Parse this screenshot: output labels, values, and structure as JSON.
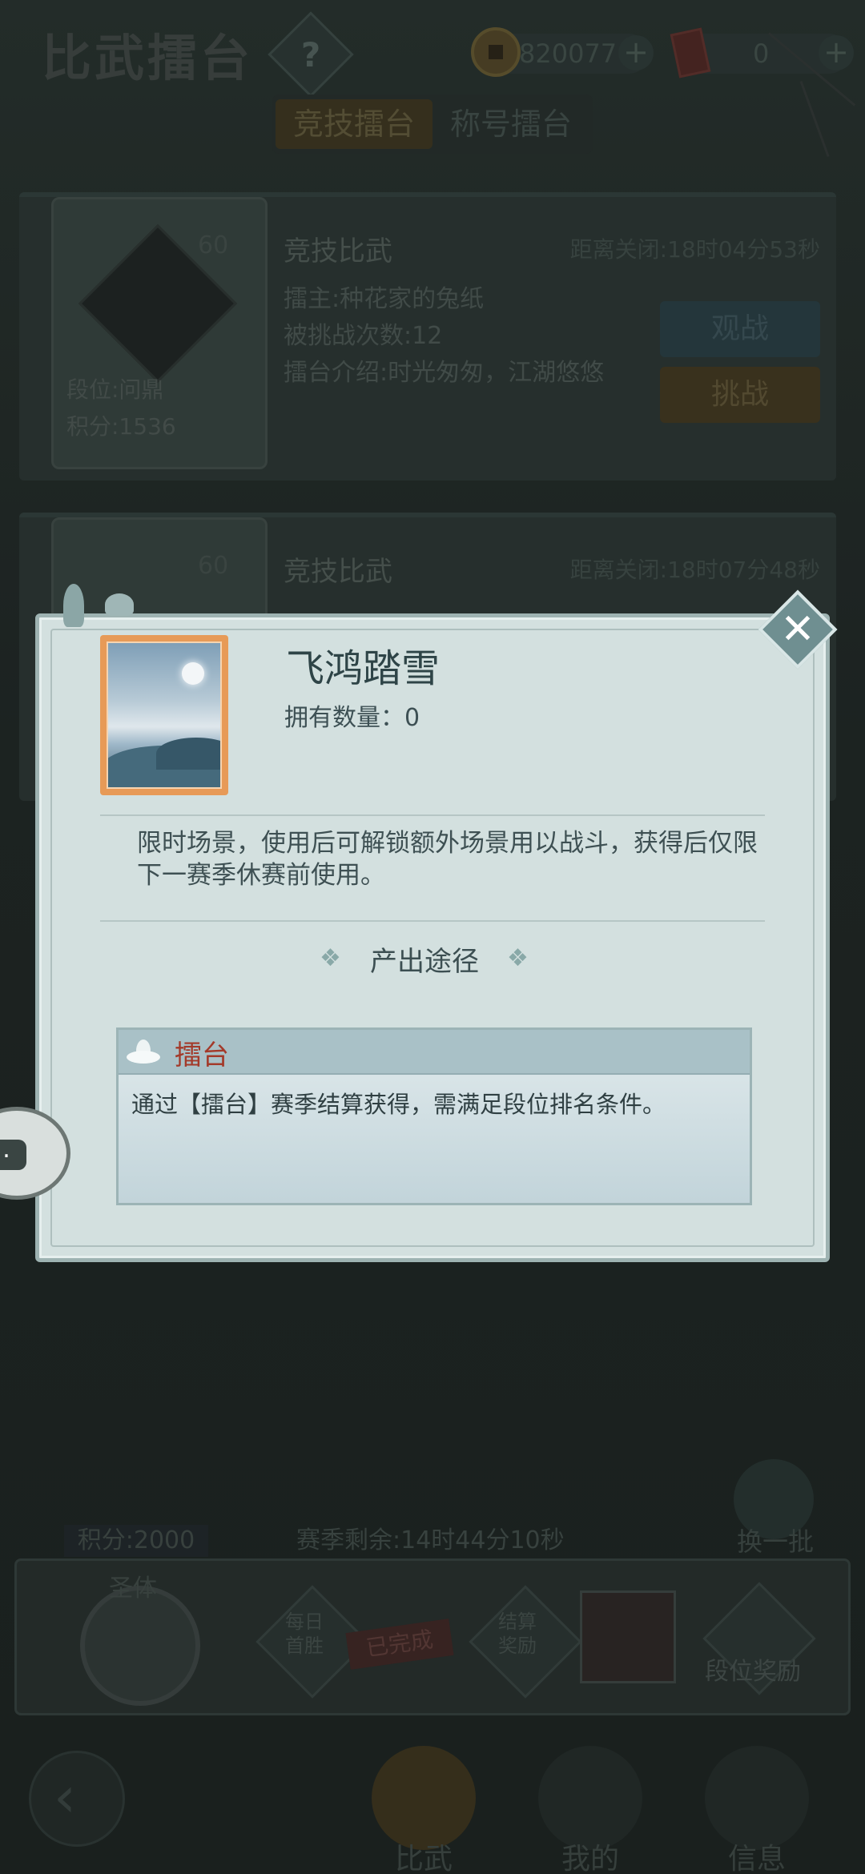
{
  "header": {
    "title": "比武擂台",
    "help_label": "?",
    "coins": "820077",
    "tickets": "0",
    "plus_label": "+"
  },
  "tabs": [
    {
      "label": "竞技擂台"
    },
    {
      "label": "称号擂台"
    }
  ],
  "cards": [
    {
      "level": "60",
      "rank": "段位:问鼎",
      "score": "积分:1536",
      "title": "竞技比武",
      "timer": "距离关闭:18时04分53秒",
      "owner": "擂主:种花家的兔纸",
      "challenged": "被挑战次数:12",
      "intro": "擂台介绍:时光匆匆，江湖悠悠",
      "watch_label": "观战",
      "fight_label": "挑战"
    },
    {
      "level": "60",
      "title": "竞技比武",
      "timer": "距离关闭:18时07分48秒"
    }
  ],
  "footer": {
    "season_left": "赛季剩余:14时44分10秒",
    "refresh_label": "换一批",
    "score_badge": "积分:2000",
    "emblem_text": "圣体",
    "daily_label": "每日首胜",
    "stamp_label": "已完成",
    "settle_label": "结算奖励",
    "rank_reward_label": "段位奖励"
  },
  "nav": [
    {
      "label": "比武"
    },
    {
      "label": "我的"
    },
    {
      "label": "信息"
    }
  ],
  "modal": {
    "item_name": "飞鸿踏雪",
    "owned": "拥有数量：0",
    "description": "限时场景，使用后可解锁额外场景用以战斗，获得后仅限下一赛季休赛前使用。",
    "source_title": "产出途径",
    "source_flower": "❖",
    "source_name": "擂台",
    "source_desc": "通过【擂台】赛季结算获得，需满足段位排名条件。",
    "close_label": "✕"
  },
  "chat": {
    "dots": "…"
  },
  "colors": {
    "modal_bg": "#d3e0df",
    "item_frame": "#e79a57",
    "source_name": "#a33a2a",
    "close_button": "#6f8f91"
  }
}
